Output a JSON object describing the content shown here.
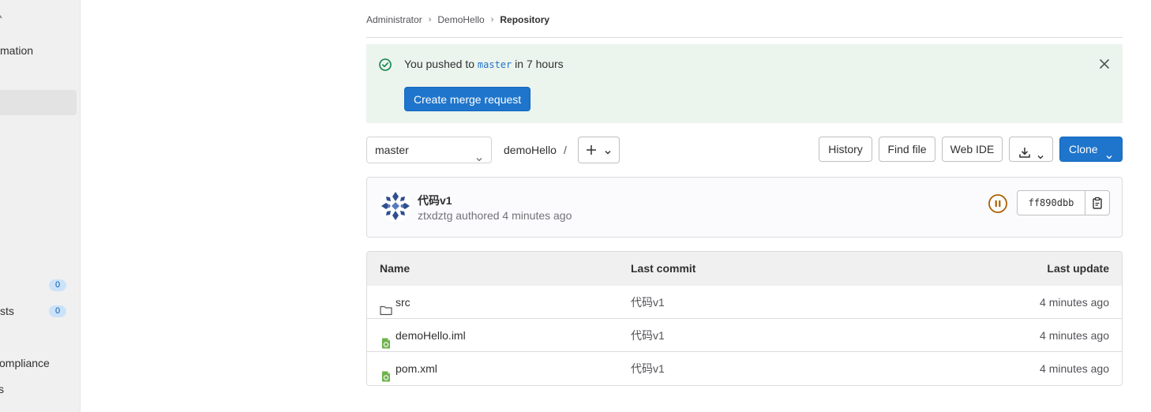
{
  "sidebar": {
    "items": [
      {
        "label": "mation"
      },
      {
        "label": ""
      },
      {
        "label": "",
        "count": "0"
      },
      {
        "label": "sts",
        "count": "0"
      },
      {
        "label": "ompliance"
      },
      {
        "label": "s"
      }
    ]
  },
  "breadcrumb": {
    "items": [
      "Administrator",
      "DemoHello"
    ],
    "current": "Repository"
  },
  "alert": {
    "text_before": "You pushed to ",
    "branch": "master",
    "text_after": " in 7 hours",
    "button_label": "Create merge request"
  },
  "toolbar": {
    "branch": "master",
    "path": "demoHello",
    "path_separator": "/",
    "history_label": "History",
    "find_file_label": "Find file",
    "web_ide_label": "Web IDE",
    "clone_label": "Clone"
  },
  "commit": {
    "title": "代码v1",
    "author": "ztxdztg",
    "authored_text": " authored ",
    "time": "4 minutes ago",
    "sha": "ff890dbb"
  },
  "files": {
    "headers": {
      "name": "Name",
      "last_commit": "Last commit",
      "last_update": "Last update"
    },
    "rows": [
      {
        "name": "src",
        "type": "folder",
        "last_commit": "代码v1",
        "last_update": "4 minutes ago"
      },
      {
        "name": "demoHello.iml",
        "type": "file",
        "last_commit": "代码v1",
        "last_update": "4 minutes ago"
      },
      {
        "name": "pom.xml",
        "type": "file",
        "last_commit": "代码v1",
        "last_update": "4 minutes ago"
      }
    ]
  },
  "colors": {
    "primary": "#1f75cb",
    "alert_bg": "#ecf4ee",
    "success": "#108548",
    "pipeline_paused": "#ab6100"
  },
  "icons": [
    "check-circle-icon",
    "close-icon",
    "chevron-down-icon",
    "plus-icon",
    "download-icon",
    "pipeline-paused-icon",
    "copy-icon",
    "folder-icon",
    "file-icon"
  ]
}
